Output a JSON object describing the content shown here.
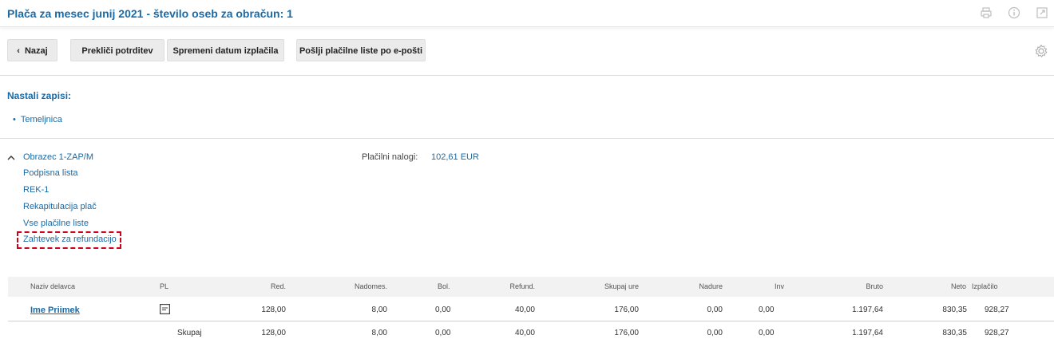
{
  "header": {
    "title": "Plača za mesec junij 2021 - število oseb za obračun: 1",
    "icons": [
      "print-icon",
      "info-icon",
      "external-link-icon"
    ]
  },
  "toolbar": {
    "back_label": "Nazaj",
    "cancel_confirm_label": "Prekliči potrditev",
    "change_date_label": "Spremeni datum izplačila",
    "send_payslips_label": "Pošlji plačilne liste po e-pošti",
    "settings_icon": "gear-icon"
  },
  "records": {
    "title": "Nastali zapisi:",
    "items": [
      "Temeljnica"
    ]
  },
  "reports": {
    "items": [
      "Obrazec 1-ZAP/M",
      "Podpisna lista",
      "REK-1",
      "Rekapitulacija plač",
      "Vse plačilne liste",
      "Zahtevek za refundacijo"
    ],
    "payment_orders_label": "Plačilni nalogi:",
    "payment_orders_value": "102,61 EUR"
  },
  "table": {
    "headers": [
      "Naziv delavca",
      "PL",
      "Red.",
      "Nadomes.",
      "Bol.",
      "Refund.",
      "Skupaj ure",
      "Nadure",
      "Inv",
      "Bruto",
      "Neto",
      "Izplačilo"
    ],
    "rows": [
      {
        "name": "Ime Priimek",
        "red": "128,00",
        "nadomes": "8,00",
        "bol": "0,00",
        "refund": "40,00",
        "skupaj_ure": "176,00",
        "nadure": "0,00",
        "inv": "0,00",
        "bruto": "1.197,64",
        "neto": "830,35",
        "izplacilo": "928,27"
      }
    ],
    "totals": {
      "label": "Skupaj",
      "red": "128,00",
      "nadomes": "8,00",
      "bol": "0,00",
      "refund": "40,00",
      "skupaj_ure": "176,00",
      "nadure": "0,00",
      "inv": "0,00",
      "bruto": "1.197,64",
      "neto": "830,35",
      "izplacilo": "928,27"
    }
  },
  "colors": {
    "accent": "#1a6aa6",
    "highlight": "#d0021b"
  }
}
